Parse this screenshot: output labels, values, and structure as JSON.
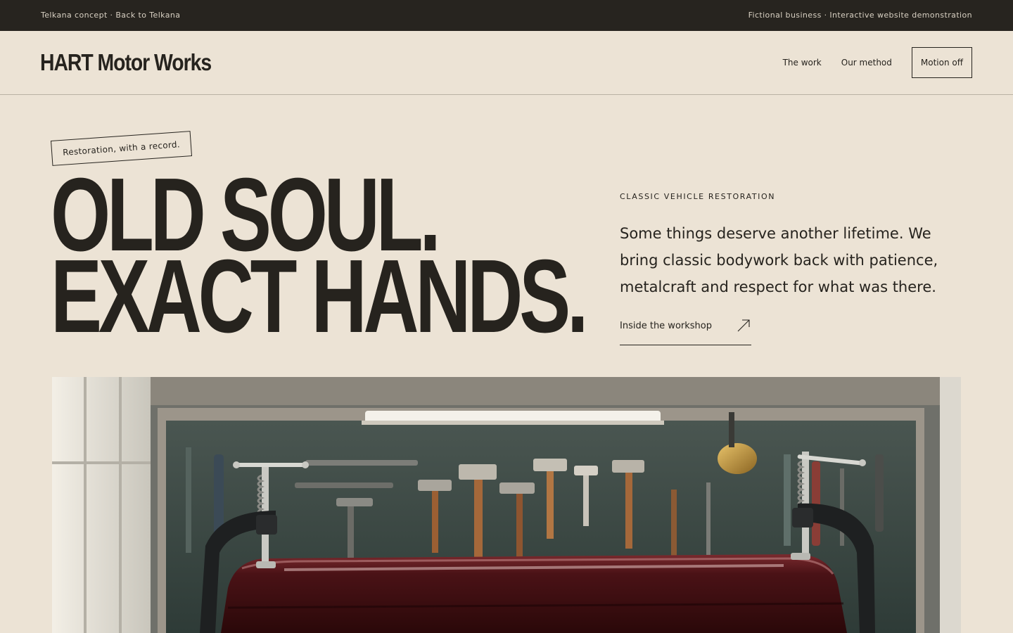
{
  "topbar": {
    "left": "Telkana concept · Back to Telkana",
    "right": "Fictional business · Interactive website demonstration"
  },
  "nav": {
    "brand": "HART Motor Works",
    "links": [
      "The work",
      "Our method"
    ],
    "motion_toggle": "Motion off"
  },
  "hero": {
    "tag": "Restoration, with a record.",
    "headline_line1": "OLD SOUL.",
    "headline_line2": "EXACT HANDS.",
    "eyebrow": "CLASSIC VEHICLE RESTORATION",
    "lede": "Some things deserve another lifetime. We bring classic bodywork back with patience, metalcraft and respect for what was there.",
    "cta": "Inside the workshop",
    "cta_icon": "arrow-up-right-icon",
    "image_subject": "workshop-photo"
  },
  "colors": {
    "background": "#ece3d5",
    "ink": "#26231e",
    "topbar": "#27241f",
    "car_paint": "#5a1a1e"
  }
}
